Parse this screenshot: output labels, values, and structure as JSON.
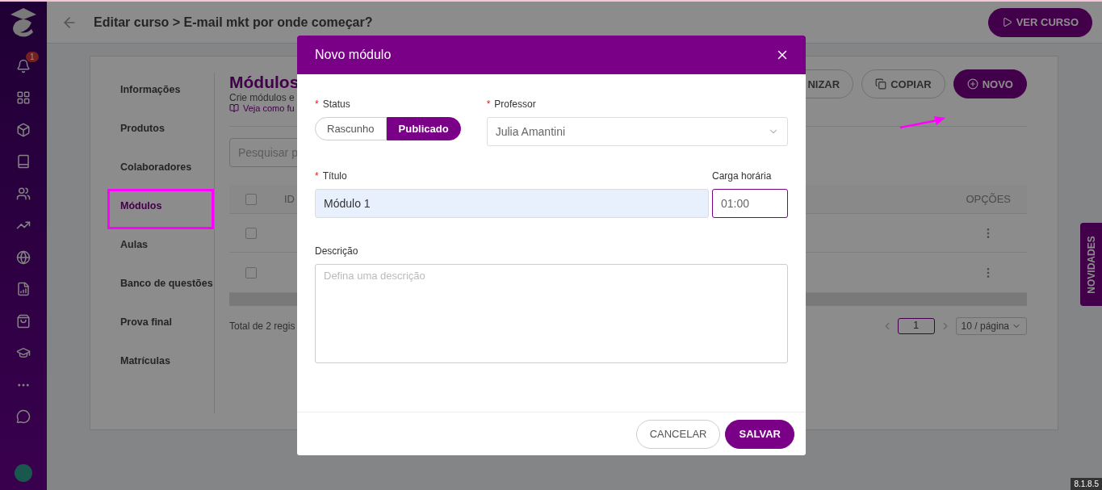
{
  "sidebar": {
    "notification_count": "1"
  },
  "header": {
    "title": "Editar curso > E-mail mkt por onde começar?",
    "action": "VER CURSO"
  },
  "course_nav": [
    {
      "label": "Informações",
      "selected": false
    },
    {
      "label": "Produtos",
      "selected": false
    },
    {
      "label": "Colaboradores",
      "selected": false
    },
    {
      "label": "Módulos",
      "selected": true
    },
    {
      "label": "Aulas",
      "selected": false
    },
    {
      "label": "Banco de questões",
      "selected": false
    },
    {
      "label": "Prova final",
      "selected": false
    },
    {
      "label": "Matrículas",
      "selected": false
    }
  ],
  "section": {
    "title": "Módulos",
    "subtitle": "Crie módulos e",
    "help_link": "Veja como fu",
    "buttons": [
      {
        "label": "NIZAR",
        "kind": "outline"
      },
      {
        "label": "COPIAR",
        "kind": "copy"
      },
      {
        "label": "NOVO",
        "kind": "primary"
      }
    ],
    "search_placeholder": "Pesquisar p",
    "columns": [
      "ID",
      "OPÇÕES"
    ],
    "header_checked": false,
    "rows": [
      {
        "checked": false
      },
      {
        "checked": false
      }
    ],
    "total": "Total de 2 regis",
    "page": "1",
    "page_size": "10 / página"
  },
  "side_tab": "NOVIDADES",
  "version": "8.1.8.5",
  "modal": {
    "title": "Novo módulo",
    "required_mark": "*",
    "status": {
      "label": "Status",
      "required": true,
      "options": [
        {
          "label": "Rascunho",
          "selected": false
        },
        {
          "label": "Publicado",
          "selected": true
        }
      ]
    },
    "professor": {
      "label": "Professor",
      "required": true,
      "value": "Julia Amantini"
    },
    "titulo": {
      "label": "Título",
      "required": true,
      "value": "Módulo 1"
    },
    "carga": {
      "label": "Carga horária",
      "required": false,
      "value": "01:00"
    },
    "descricao": {
      "label": "Descrição",
      "required": false,
      "placeholder": "Defina uma descrição"
    },
    "cancel": "CANCELAR",
    "save": "SALVAR"
  }
}
